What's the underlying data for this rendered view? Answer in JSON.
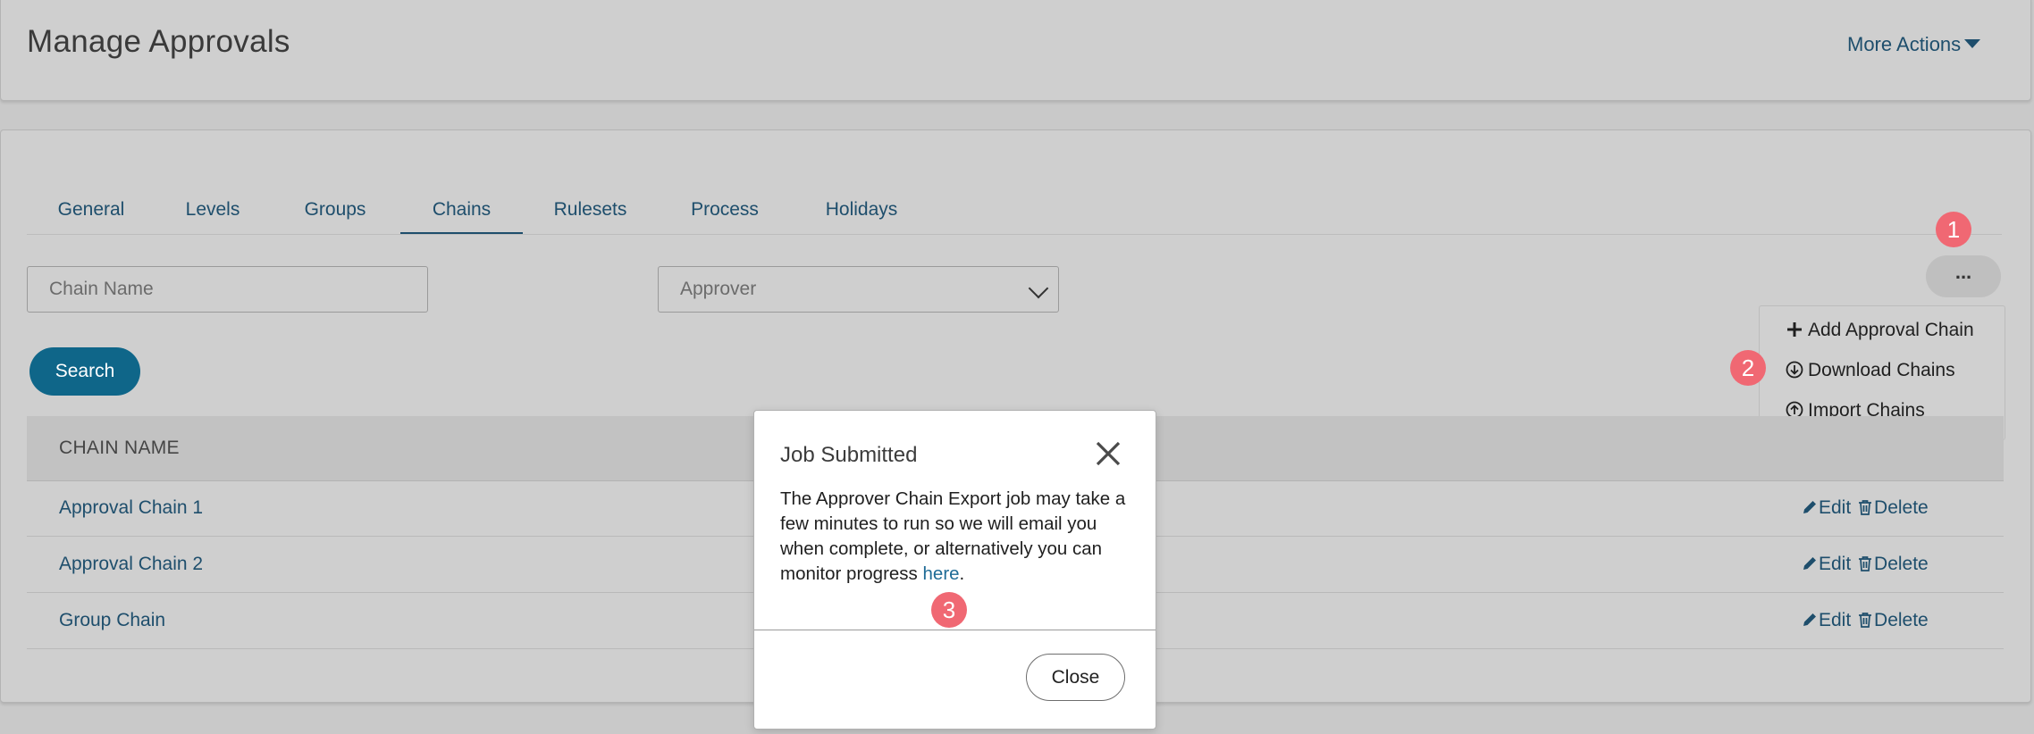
{
  "header": {
    "title": "Manage Approvals",
    "more_actions_label": "More Actions"
  },
  "tabs": [
    {
      "label": "General",
      "active": false
    },
    {
      "label": "Levels",
      "active": false
    },
    {
      "label": "Groups",
      "active": false
    },
    {
      "label": "Chains",
      "active": true
    },
    {
      "label": "Rulesets",
      "active": false
    },
    {
      "label": "Process",
      "active": false
    },
    {
      "label": "Holidays",
      "active": false
    }
  ],
  "filters": {
    "chain_name_placeholder": "Chain Name",
    "approver_placeholder": "Approver",
    "search_label": "Search"
  },
  "menu": {
    "trigger_label": "...",
    "items": [
      {
        "label": "Add Approval Chain",
        "icon": "plus-icon"
      },
      {
        "label": "Download Chains",
        "icon": "circle-arrow-down-icon"
      },
      {
        "label": "Import Chains",
        "icon": "circle-arrow-up-icon"
      }
    ]
  },
  "table": {
    "column_header": "CHAIN NAME",
    "edit_label": "Edit",
    "delete_label": "Delete",
    "rows": [
      {
        "name": "Approval Chain 1"
      },
      {
        "name": "Approval Chain 2"
      },
      {
        "name": "Group Chain"
      }
    ]
  },
  "modal": {
    "title": "Job Submitted",
    "body_text": "The Approver Chain Export job may take a few minutes to run so we will email you when complete, or alternatively you can monitor progress ",
    "link_text": "here",
    "body_suffix": ".",
    "close_label": "Close"
  },
  "annotations": [
    "1",
    "2",
    "3"
  ],
  "colors": {
    "accent": "#1e4e6c",
    "primary_button": "#0f6689",
    "badge": "#f06873",
    "background": "#c9c9c9"
  }
}
